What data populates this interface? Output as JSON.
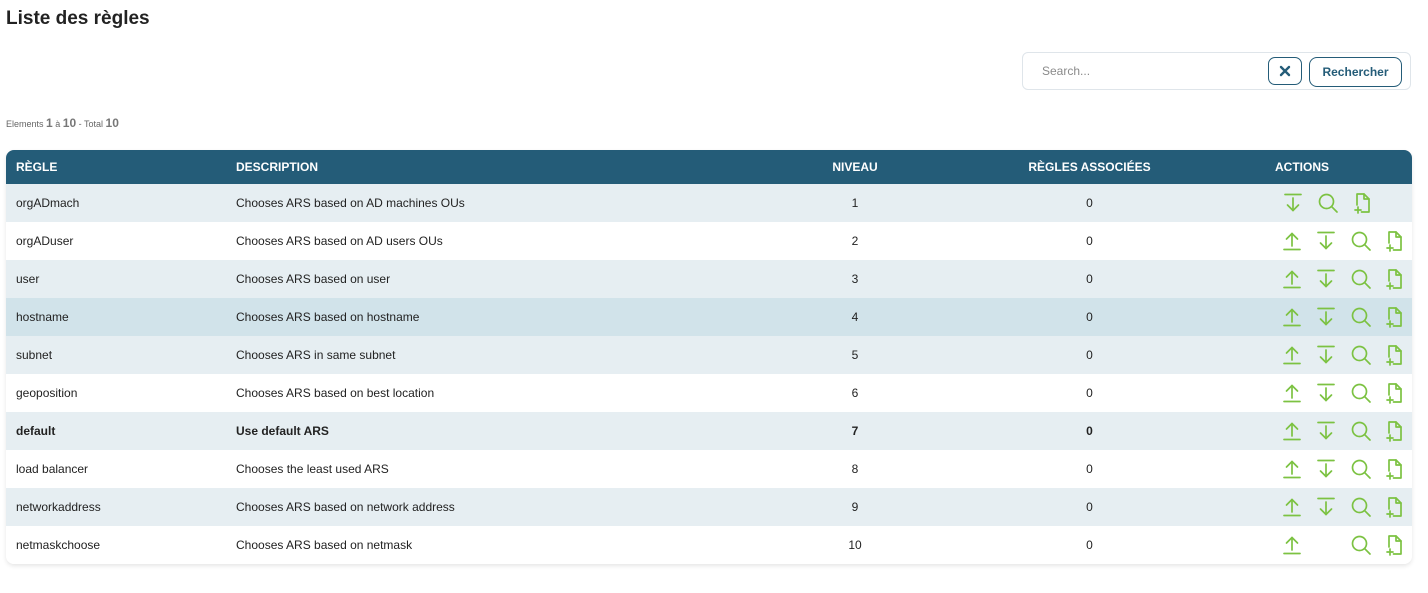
{
  "page": {
    "title": "Liste des règles"
  },
  "search": {
    "placeholder": "Search...",
    "value": "",
    "button_label": "Rechercher"
  },
  "pagination": {
    "prefix": "Elements",
    "from": "1",
    "between": "à",
    "to": "10",
    "total_label": "- Total",
    "total": "10"
  },
  "colors": {
    "header_bg": "#245c78",
    "action_icon": "#7cc242",
    "row_odd": "#e6eef2",
    "row_highlight": "#d1e3ea"
  },
  "table": {
    "headers": [
      "RÈGLE",
      "DESCRIPTION",
      "NIVEAU",
      "RÈGLES ASSOCIÉES",
      "ACTIONS"
    ],
    "rows": [
      {
        "rule": "orgADmach",
        "description": "Chooses ARS based on AD machines OUs",
        "level": "1",
        "associated": "0",
        "actions": [
          "arrow-down-icon",
          "search-icon",
          "add-file-icon"
        ]
      },
      {
        "rule": "orgADuser",
        "description": "Chooses ARS based on AD users OUs",
        "level": "2",
        "associated": "0",
        "actions": [
          "arrow-up-icon",
          "arrow-down-icon",
          "search-icon",
          "add-file-icon"
        ]
      },
      {
        "rule": "user",
        "description": "Chooses ARS based on user",
        "level": "3",
        "associated": "0",
        "actions": [
          "arrow-up-icon",
          "arrow-down-icon",
          "search-icon",
          "add-file-icon"
        ]
      },
      {
        "rule": "hostname",
        "description": "Chooses ARS based on hostname",
        "level": "4",
        "associated": "0",
        "actions": [
          "arrow-up-icon",
          "arrow-down-icon",
          "search-icon",
          "add-file-icon"
        ],
        "highlighted": true
      },
      {
        "rule": "subnet",
        "description": "Chooses ARS in same subnet",
        "level": "5",
        "associated": "0",
        "actions": [
          "arrow-up-icon",
          "arrow-down-icon",
          "search-icon",
          "add-file-icon"
        ]
      },
      {
        "rule": "geoposition",
        "description": "Chooses ARS based on best location",
        "level": "6",
        "associated": "0",
        "actions": [
          "arrow-up-icon",
          "arrow-down-icon",
          "search-icon",
          "add-file-icon"
        ]
      },
      {
        "rule": "default",
        "description": "Use default ARS",
        "level": "7",
        "associated": "0",
        "actions": [
          "arrow-up-icon",
          "arrow-down-icon",
          "search-icon",
          "add-file-icon"
        ],
        "bold": true
      },
      {
        "rule": "load balancer",
        "description": "Chooses the least used ARS",
        "level": "8",
        "associated": "0",
        "actions": [
          "arrow-up-icon",
          "arrow-down-icon",
          "search-icon",
          "add-file-icon"
        ]
      },
      {
        "rule": "networkaddress",
        "description": "Chooses ARS based on network address",
        "level": "9",
        "associated": "0",
        "actions": [
          "arrow-up-icon",
          "arrow-down-icon",
          "search-icon",
          "add-file-icon"
        ]
      },
      {
        "rule": "netmaskchoose",
        "description": "Chooses ARS based on netmask",
        "level": "10",
        "associated": "0",
        "actions": [
          "arrow-up-icon",
          "",
          "search-icon",
          "add-file-icon"
        ]
      }
    ]
  }
}
